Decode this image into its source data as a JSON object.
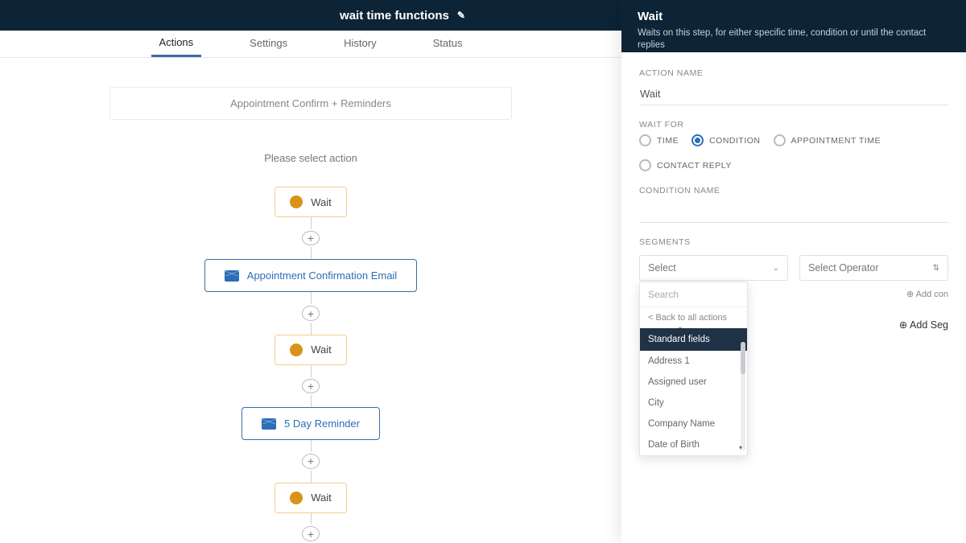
{
  "header": {
    "title": "wait time functions"
  },
  "tabs": [
    {
      "label": "Actions",
      "active": true
    },
    {
      "label": "Settings"
    },
    {
      "label": "History"
    },
    {
      "label": "Status"
    }
  ],
  "canvas": {
    "workflow_title": "Appointment Confirm + Reminders",
    "prompt": "Please select action",
    "nodes": [
      {
        "type": "wait",
        "label": "Wait"
      },
      {
        "type": "email",
        "label": "Appointment Confirmation Email"
      },
      {
        "type": "wait",
        "label": "Wait"
      },
      {
        "type": "email",
        "label": "5 Day Reminder"
      },
      {
        "type": "wait",
        "label": "Wait"
      }
    ]
  },
  "panel": {
    "title": "Wait",
    "desc": "Waits on this step, for either specific time, condition or until the contact replies",
    "action_name_label": "ACTION NAME",
    "action_name_value": "Wait",
    "wait_for_label": "WAIT FOR",
    "wait_for_options": [
      {
        "label": "TIME",
        "selected": false
      },
      {
        "label": "CONDITION",
        "selected": true
      },
      {
        "label": "APPOINTMENT TIME",
        "selected": false
      },
      {
        "label": "CONTACT REPLY",
        "selected": false
      }
    ],
    "condition_name_label": "CONDITION NAME",
    "condition_name_value": "",
    "segments_label": "SEGMENTS",
    "select1": "Select",
    "select2": "Select Operator",
    "add_cond": "⊕ Add con",
    "add_segment": "⊕ Add Seg",
    "dropdown": {
      "search": "Search",
      "back": "< Back to all actions",
      "group": "Standard fields",
      "items": [
        "Address 1",
        "Assigned user",
        "City",
        "Company Name",
        "Date of Birth"
      ]
    }
  }
}
